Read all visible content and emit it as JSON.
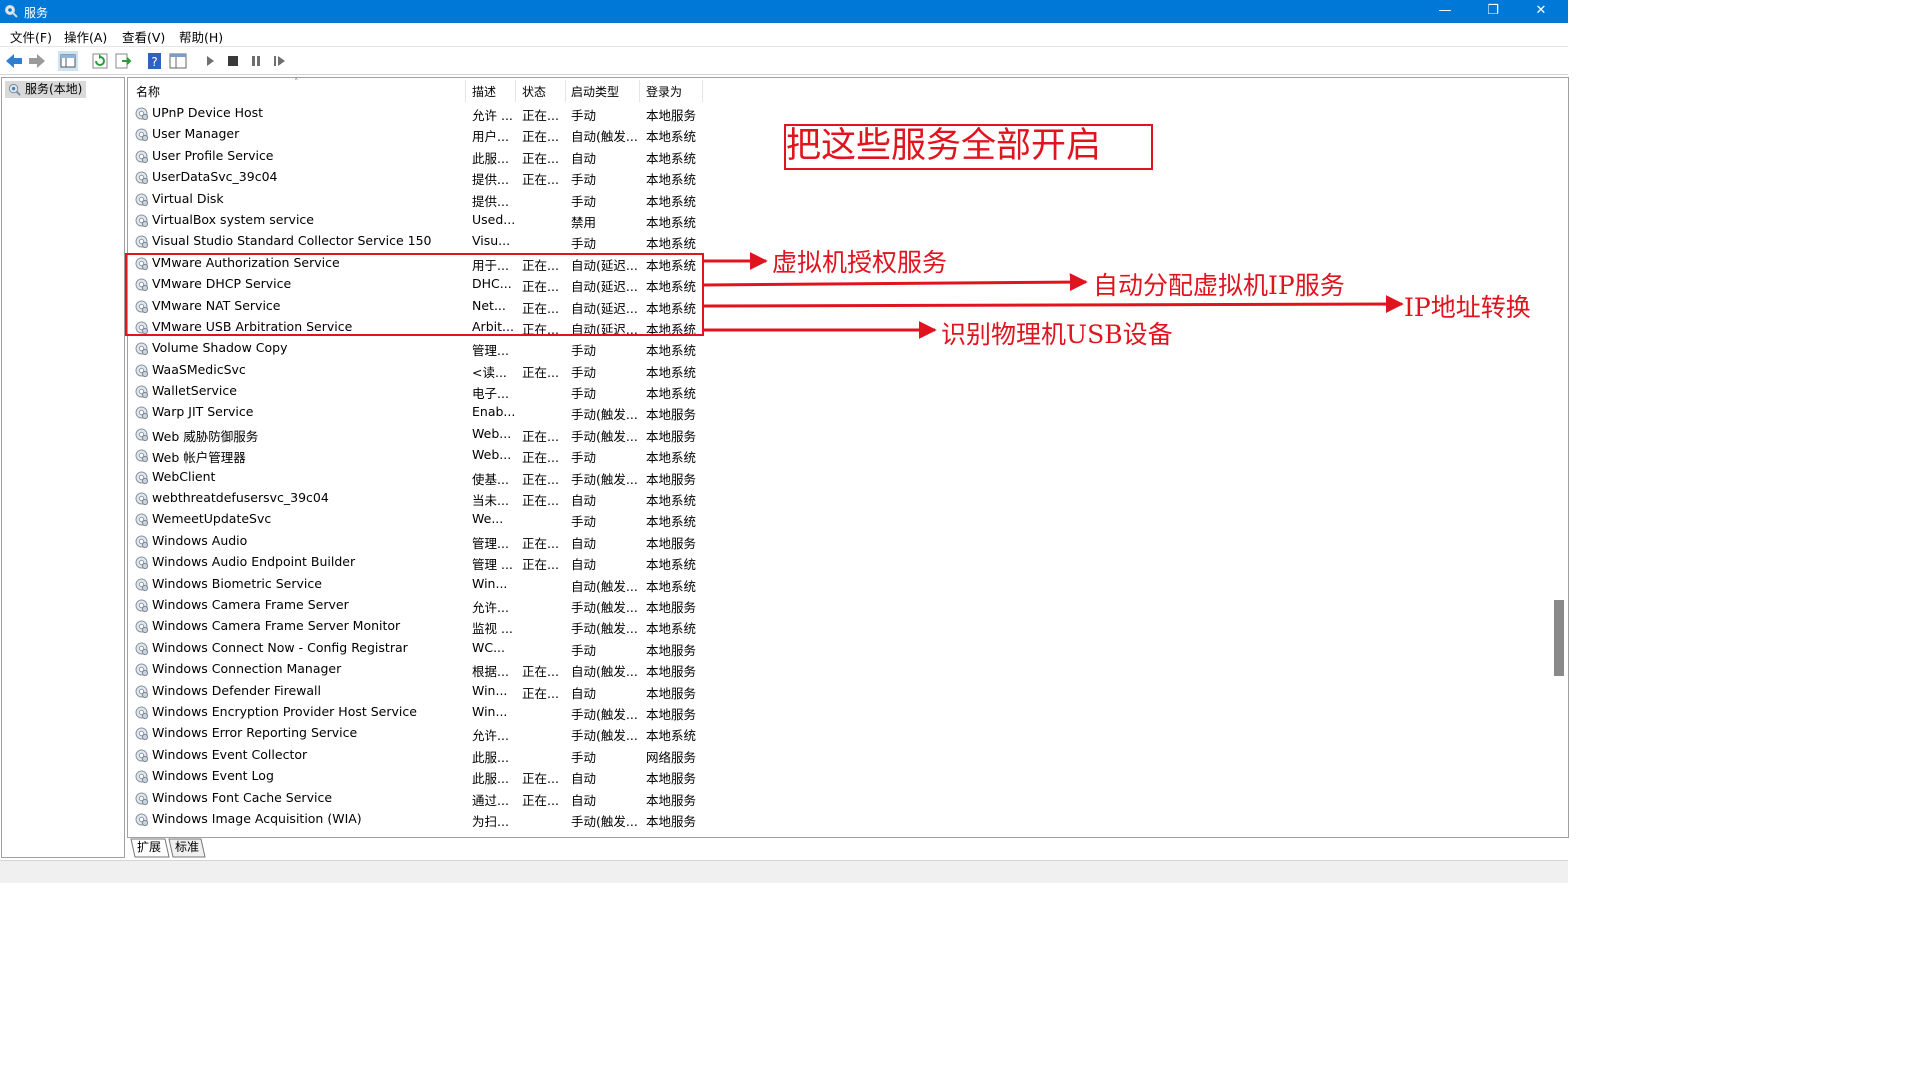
{
  "window": {
    "title": "服务",
    "minimize": "—",
    "restore": "❐",
    "close": "✕"
  },
  "menu": [
    "文件(F)",
    "操作(A)",
    "查看(V)",
    "帮助(H)"
  ],
  "tree": {
    "node": "服务(本地)"
  },
  "columns": {
    "name": "名称",
    "desc": "描述",
    "status": "状态",
    "start": "启动类型",
    "logon": "登录为"
  },
  "services": [
    {
      "name": "UPnP Device Host",
      "desc": "允许 ...",
      "status": "正在...",
      "start": "手动",
      "logon": "本地服务"
    },
    {
      "name": "User Manager",
      "desc": "用户...",
      "status": "正在...",
      "start": "自动(触发...",
      "logon": "本地系统"
    },
    {
      "name": "User Profile Service",
      "desc": "此服...",
      "status": "正在...",
      "start": "自动",
      "logon": "本地系统"
    },
    {
      "name": "UserDataSvc_39c04",
      "desc": "提供...",
      "status": "正在...",
      "start": "手动",
      "logon": "本地系统"
    },
    {
      "name": "Virtual Disk",
      "desc": "提供...",
      "status": "",
      "start": "手动",
      "logon": "本地系统"
    },
    {
      "name": "VirtualBox system service",
      "desc": "Used...",
      "status": "",
      "start": "禁用",
      "logon": "本地系统"
    },
    {
      "name": "Visual Studio Standard Collector Service 150",
      "desc": "Visu...",
      "status": "",
      "start": "手动",
      "logon": "本地系统"
    },
    {
      "name": "VMware Authorization Service",
      "desc": "用于...",
      "status": "正在...",
      "start": "自动(延迟...",
      "logon": "本地系统"
    },
    {
      "name": "VMware DHCP Service",
      "desc": "DHC...",
      "status": "正在...",
      "start": "自动(延迟...",
      "logon": "本地系统"
    },
    {
      "name": "VMware NAT Service",
      "desc": "Net...",
      "status": "正在...",
      "start": "自动(延迟...",
      "logon": "本地系统"
    },
    {
      "name": "VMware USB Arbitration Service",
      "desc": "Arbit...",
      "status": "正在...",
      "start": "自动(延迟...",
      "logon": "本地系统"
    },
    {
      "name": "Volume Shadow Copy",
      "desc": "管理...",
      "status": "",
      "start": "手动",
      "logon": "本地系统"
    },
    {
      "name": "WaaSMedicSvc",
      "desc": "<读...",
      "status": "正在...",
      "start": "手动",
      "logon": "本地系统"
    },
    {
      "name": "WalletService",
      "desc": "电子...",
      "status": "",
      "start": "手动",
      "logon": "本地系统"
    },
    {
      "name": "Warp JIT Service",
      "desc": "Enab...",
      "status": "",
      "start": "手动(触发...",
      "logon": "本地服务"
    },
    {
      "name": "Web 威胁防御服务",
      "desc": "Web...",
      "status": "正在...",
      "start": "手动(触发...",
      "logon": "本地服务"
    },
    {
      "name": "Web 帐户管理器",
      "desc": "Web...",
      "status": "正在...",
      "start": "手动",
      "logon": "本地系统"
    },
    {
      "name": "WebClient",
      "desc": "使基...",
      "status": "正在...",
      "start": "手动(触发...",
      "logon": "本地服务"
    },
    {
      "name": "webthreatdefusersvc_39c04",
      "desc": "当未...",
      "status": "正在...",
      "start": "自动",
      "logon": "本地系统"
    },
    {
      "name": "WemeetUpdateSvc",
      "desc": "We...",
      "status": "",
      "start": "手动",
      "logon": "本地系统"
    },
    {
      "name": "Windows Audio",
      "desc": "管理...",
      "status": "正在...",
      "start": "自动",
      "logon": "本地服务"
    },
    {
      "name": "Windows Audio Endpoint Builder",
      "desc": "管理 ...",
      "status": "正在...",
      "start": "自动",
      "logon": "本地系统"
    },
    {
      "name": "Windows Biometric Service",
      "desc": "Win...",
      "status": "",
      "start": "自动(触发...",
      "logon": "本地系统"
    },
    {
      "name": "Windows Camera Frame Server",
      "desc": "允许...",
      "status": "",
      "start": "手动(触发...",
      "logon": "本地服务"
    },
    {
      "name": "Windows Camera Frame Server Monitor",
      "desc": "监视 ...",
      "status": "",
      "start": "手动(触发...",
      "logon": "本地系统"
    },
    {
      "name": "Windows Connect Now - Config Registrar",
      "desc": "WC...",
      "status": "",
      "start": "手动",
      "logon": "本地服务"
    },
    {
      "name": "Windows Connection Manager",
      "desc": "根据...",
      "status": "正在...",
      "start": "自动(触发...",
      "logon": "本地服务"
    },
    {
      "name": "Windows Defender Firewall",
      "desc": "Win...",
      "status": "正在...",
      "start": "自动",
      "logon": "本地服务"
    },
    {
      "name": "Windows Encryption Provider Host Service",
      "desc": "Win...",
      "status": "",
      "start": "手动(触发...",
      "logon": "本地服务"
    },
    {
      "name": "Windows Error Reporting Service",
      "desc": "允许...",
      "status": "",
      "start": "手动(触发...",
      "logon": "本地系统"
    },
    {
      "name": "Windows Event Collector",
      "desc": "此服...",
      "status": "",
      "start": "手动",
      "logon": "网络服务"
    },
    {
      "name": "Windows Event Log",
      "desc": "此服...",
      "status": "正在...",
      "start": "自动",
      "logon": "本地服务"
    },
    {
      "name": "Windows Font Cache Service",
      "desc": "通过...",
      "status": "正在...",
      "start": "自动",
      "logon": "本地服务"
    },
    {
      "name": "Windows Image Acquisition (WIA)",
      "desc": "为扫...",
      "status": "",
      "start": "手动(触发...",
      "logon": "本地服务"
    }
  ],
  "tabs": {
    "extended": "扩展",
    "standard": "标准"
  },
  "annotations": {
    "headline": "把这些服务全部开启",
    "auth": "虚拟机授权服务",
    "dhcp": "自动分配虚拟机IP服务",
    "nat": "IP地址转换",
    "usb": "识别物理机USB设备"
  },
  "colors": {
    "titlebar": "#0078d7",
    "annotation": "#e0141e"
  },
  "icons": [
    "services-gear-icon",
    "back-arrow-icon",
    "forward-arrow-icon",
    "show-hide-tree-icon",
    "refresh-icon",
    "export-list-icon",
    "help-icon",
    "properties-icon",
    "start-service-icon",
    "stop-service-icon",
    "pause-service-icon",
    "restart-service-icon"
  ]
}
